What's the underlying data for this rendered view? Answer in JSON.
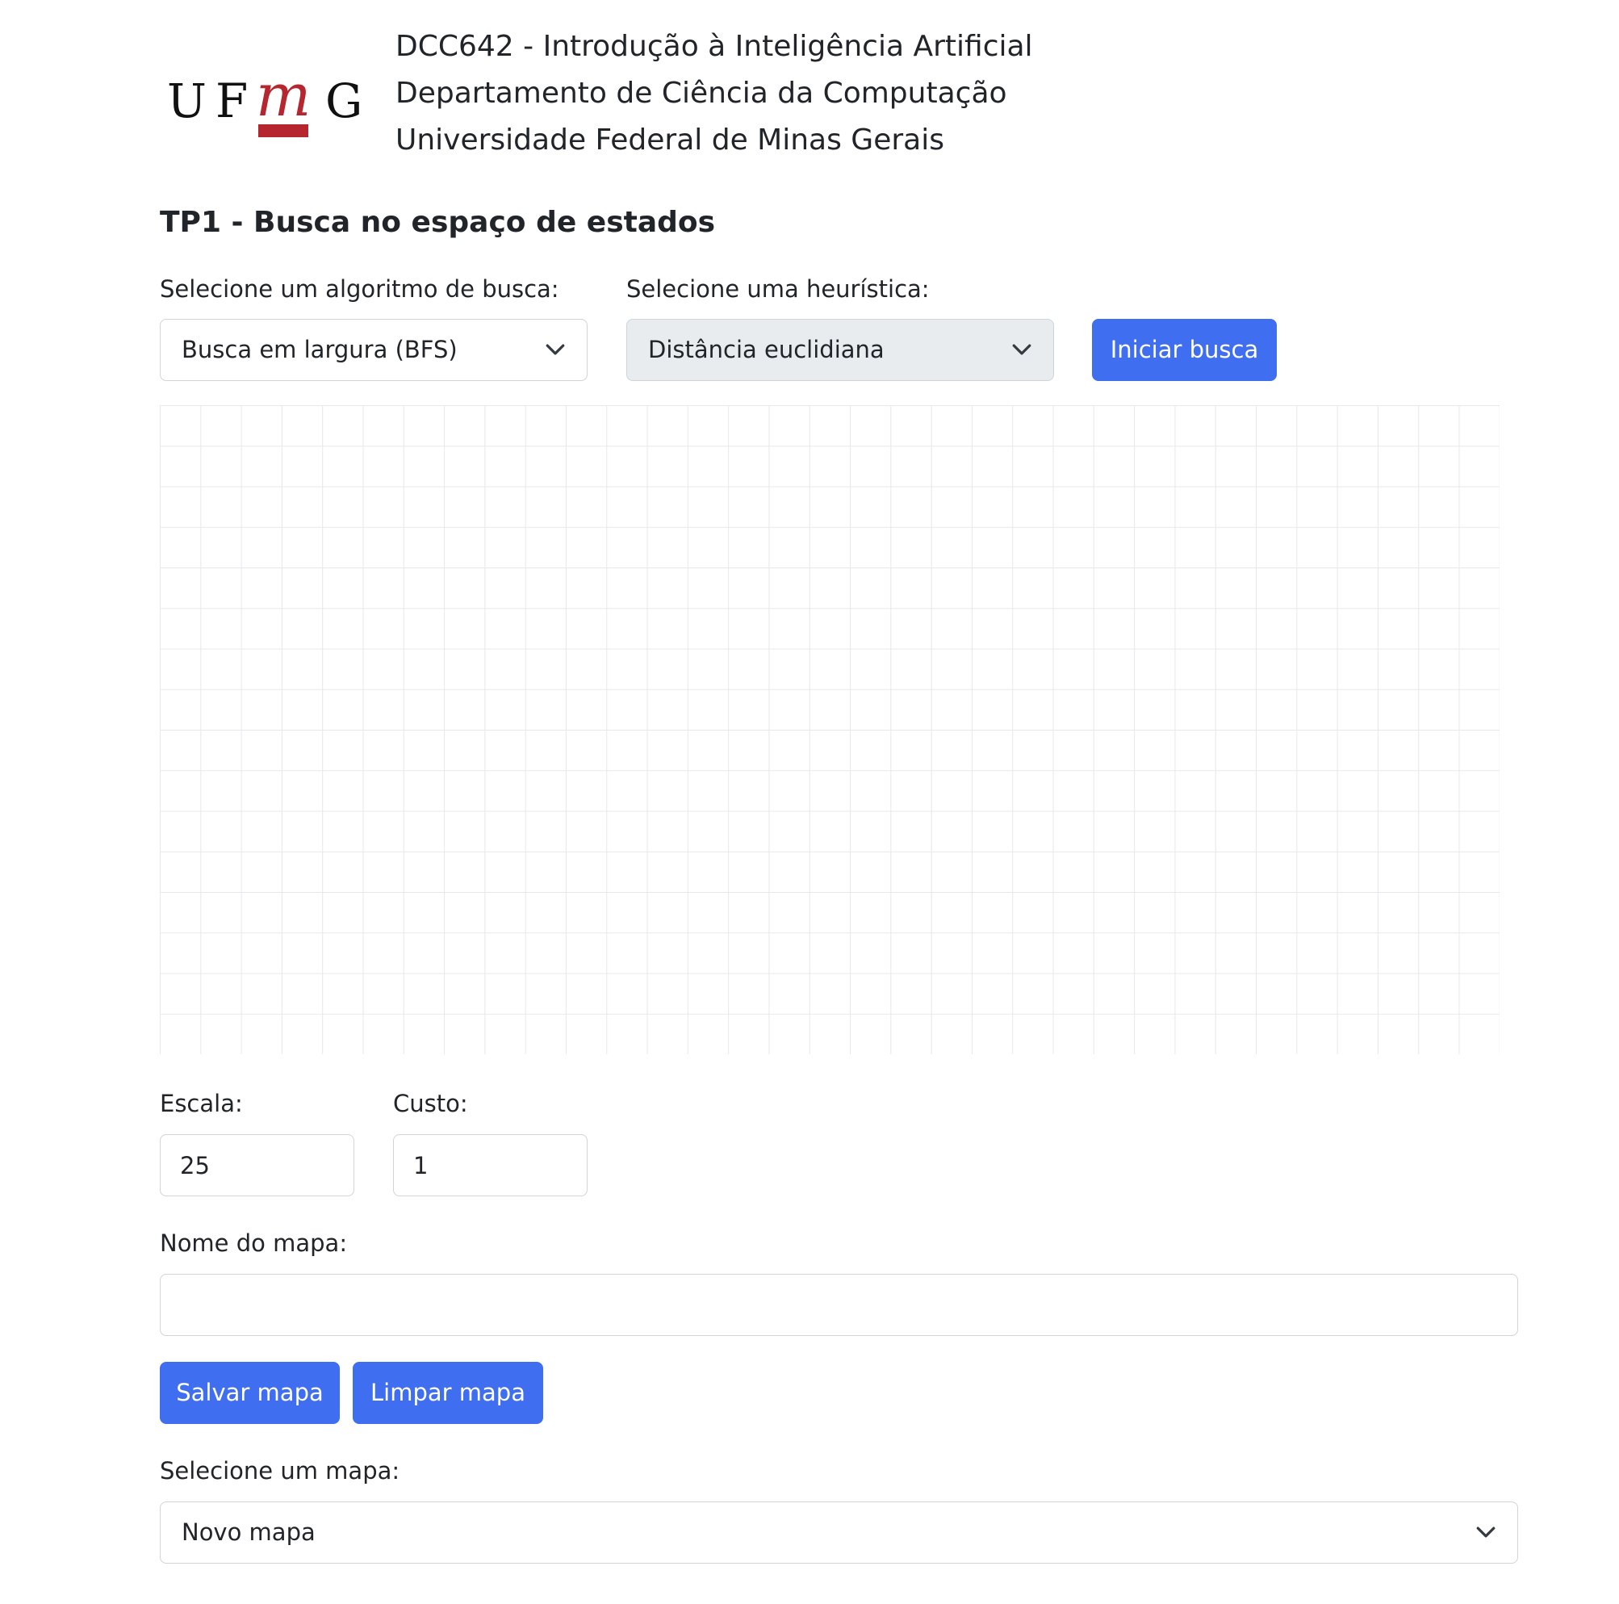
{
  "header": {
    "logo_text": "UFMG",
    "logo": {
      "letters": [
        "U",
        "F",
        "m",
        "G"
      ]
    },
    "lines": [
      "DCC642 - Introdução à Inteligência Artificial",
      "Departamento de Ciência da Computação",
      "Universidade Federal de Minas Gerais"
    ]
  },
  "page_title": "TP1 - Busca no espaço de estados",
  "search": {
    "algorithm_label": "Selecione um algoritmo de busca:",
    "algorithm_value": "Busca em largura (BFS)",
    "heuristic_label": "Selecione uma heurística:",
    "heuristic_value": "Distância euclidiana",
    "start_button": "Iniciar busca"
  },
  "grid": {
    "columns": 33,
    "rows": 16,
    "line_color": "#e6e8eb"
  },
  "settings": {
    "scale_label": "Escala:",
    "scale_value": "25",
    "cost_label": "Custo:",
    "cost_value": "1"
  },
  "map": {
    "name_label": "Nome do mapa:",
    "name_value": "",
    "save_button": "Salvar mapa",
    "clear_button": "Limpar mapa",
    "select_label": "Selecione um mapa:",
    "select_value": "Novo mapa"
  },
  "colors": {
    "primary": "#3f6ff0",
    "brand_red": "#b5262f",
    "text": "#212529",
    "border": "#ced4da",
    "disabled_bg": "#e9ecef"
  },
  "icons": {
    "dropdown": "chevron-down-icon"
  }
}
